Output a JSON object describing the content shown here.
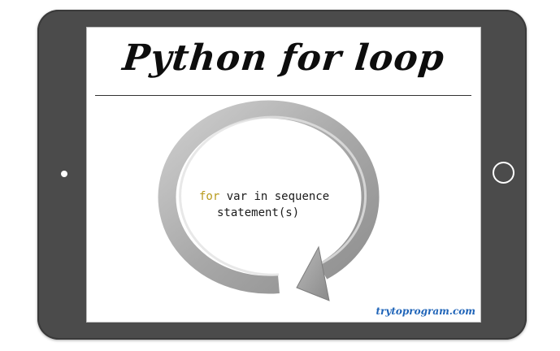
{
  "title": "Python for loop",
  "code": {
    "keyword": "for",
    "line1_rest": " var in sequence",
    "line2": "statement(s)"
  },
  "watermark": "trytoprogram.com",
  "colors": {
    "device_frame": "#4b4b4b",
    "screen": "#ffffff",
    "keyword": "#b89a1b",
    "watermark": "#1f64b8",
    "arrow": "#a3a3a3"
  },
  "icons": {
    "loop_arrow": "circular-arrow-icon",
    "home_button": "circle-button-icon",
    "camera": "dot-icon"
  }
}
